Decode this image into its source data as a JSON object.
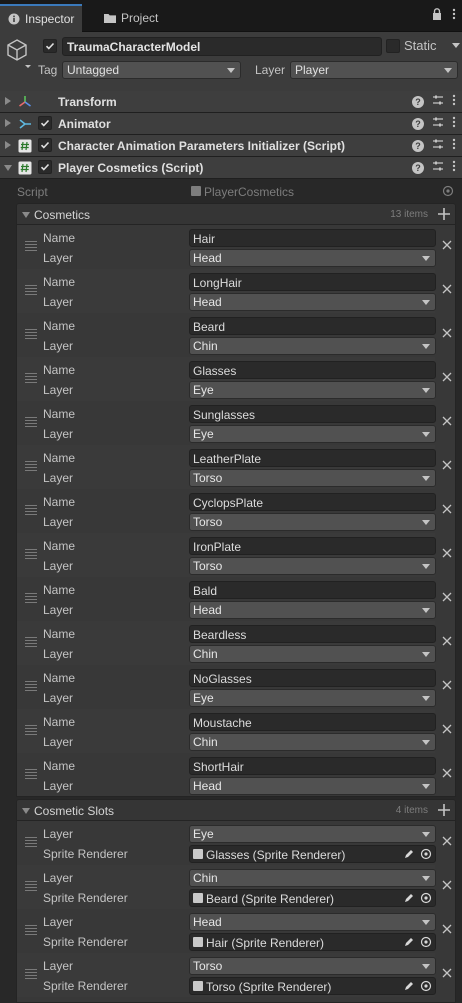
{
  "tabs": {
    "inspector_label": "Inspector",
    "project_label": "Project"
  },
  "object": {
    "name": "TraumaCharacterModel",
    "static_label": "Static",
    "tag_label": "Tag",
    "tag_value": "Untagged",
    "layer_label": "Layer",
    "layer_value": "Player"
  },
  "components": [
    {
      "title": "Transform",
      "icon": "transform-icon"
    },
    {
      "title": "Animator",
      "icon": "animator-icon"
    },
    {
      "title": "Character Animation Parameters Initializer (Script)",
      "icon": "script-icon"
    },
    {
      "title": "Player Cosmetics (Script)",
      "icon": "script-icon"
    }
  ],
  "script_row": {
    "label": "Script",
    "value": "PlayerCosmetics"
  },
  "cosmetics": {
    "title": "Cosmetics",
    "count": "13 items",
    "name_label": "Name",
    "layer_label": "Layer",
    "items": [
      {
        "name": "Hair",
        "layer": "Head"
      },
      {
        "name": "LongHair",
        "layer": "Head"
      },
      {
        "name": "Beard",
        "layer": "Chin"
      },
      {
        "name": "Glasses",
        "layer": "Eye"
      },
      {
        "name": "Sunglasses",
        "layer": "Eye"
      },
      {
        "name": "LeatherPlate",
        "layer": "Torso"
      },
      {
        "name": "CyclopsPlate",
        "layer": "Torso"
      },
      {
        "name": "IronPlate",
        "layer": "Torso"
      },
      {
        "name": "Bald",
        "layer": "Head"
      },
      {
        "name": "Beardless",
        "layer": "Chin"
      },
      {
        "name": "NoGlasses",
        "layer": "Eye"
      },
      {
        "name": "Moustache",
        "layer": "Chin"
      },
      {
        "name": "ShortHair",
        "layer": "Head"
      }
    ]
  },
  "slots": {
    "title": "Cosmetic Slots",
    "count": "4 items",
    "layer_label": "Layer",
    "renderer_label": "Sprite Renderer",
    "items": [
      {
        "layer": "Eye",
        "renderer": "Glasses (Sprite Renderer)"
      },
      {
        "layer": "Chin",
        "renderer": "Beard (Sprite Renderer)"
      },
      {
        "layer": "Head",
        "renderer": "Hair (Sprite Renderer)"
      },
      {
        "layer": "Torso",
        "renderer": "Torso (Sprite Renderer)"
      }
    ]
  },
  "colors": {
    "accent": "#3a79bb",
    "panel": "#3c3c3c",
    "background": "#282828"
  }
}
